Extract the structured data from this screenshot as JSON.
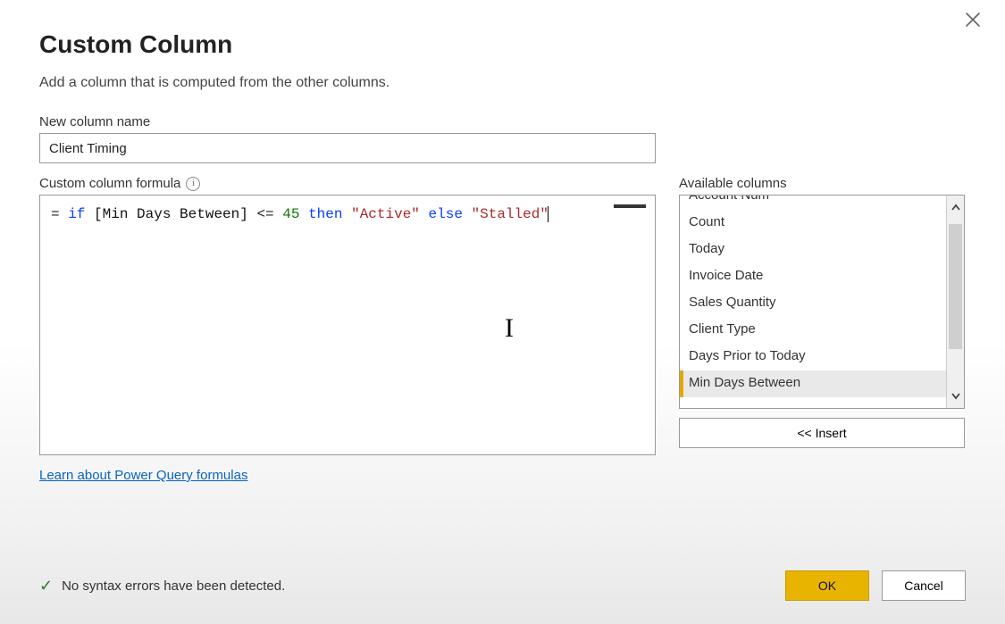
{
  "header": {
    "title": "Custom Column",
    "subtitle": "Add a column that is computed from the other columns."
  },
  "newColumn": {
    "label": "New column name",
    "value": "Client Timing"
  },
  "formula": {
    "label": "Custom column formula",
    "prefix": "= ",
    "kw_if": "if",
    "column_ref": "[Min Days Between]",
    "op": "<=",
    "number": "45",
    "kw_then": "then",
    "str_active": "\"Active\"",
    "kw_else": "else",
    "str_stalled": "\"Stalled\"",
    "raw": "= if [Min Days Between] <= 45 then \"Active\" else \"Stalled\""
  },
  "available": {
    "label": "Available columns",
    "items": [
      "Account Num",
      "Count",
      "Today",
      "Invoice Date",
      "Sales Quantity",
      "Client Type",
      "Days Prior to Today",
      "Min Days Between"
    ],
    "selected_index": 7,
    "insert_label": "<< Insert"
  },
  "link": {
    "label": "Learn about Power Query formulas"
  },
  "status": {
    "message": "No syntax errors have been detected."
  },
  "buttons": {
    "ok": "OK",
    "cancel": "Cancel"
  }
}
